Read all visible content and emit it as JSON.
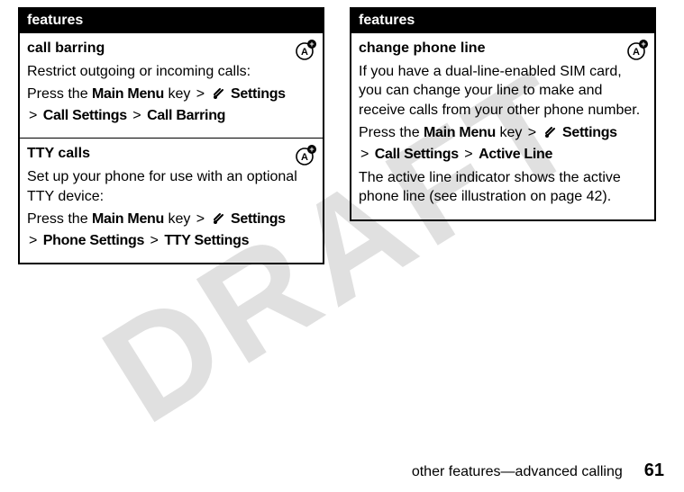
{
  "watermark": "DRAFT",
  "left": {
    "header": "features",
    "rows": [
      {
        "title": "call barring",
        "desc": "Restrict outgoing or incoming calls:",
        "instr_prefix": "Press the ",
        "main_menu": "Main Menu",
        "key_text": " key ",
        "gt": ">",
        "settings": "Settings",
        "path_a": "Call Settings",
        "path_b": "Call Barring"
      },
      {
        "title": "TTY calls",
        "desc": "Set up your phone for use with an optional TTY device:",
        "instr_prefix": "Press the ",
        "main_menu": "Main Menu",
        "key_text": " key ",
        "gt": ">",
        "settings": "Settings",
        "path_a": "Phone Settings",
        "path_b": "TTY Settings"
      }
    ]
  },
  "right": {
    "header": "features",
    "rows": [
      {
        "title": "change phone line",
        "desc": "If you have a dual-line-enabled SIM card, you can change your line to make and receive calls from your other phone number.",
        "instr_prefix": "Press the ",
        "main_menu": "Main Menu",
        "key_text": " key ",
        "gt": ">",
        "settings": "Settings",
        "path_a": "Call Settings",
        "path_b": "Active Line",
        "note": "The active line indicator shows the active phone line (see illustration on page 42)."
      }
    ]
  },
  "footer": {
    "section": "other features—advanced calling",
    "page": "61"
  },
  "icons": {
    "badge_alt": "carrier-feature-icon",
    "tool_alt": "settings-tool-icon"
  }
}
